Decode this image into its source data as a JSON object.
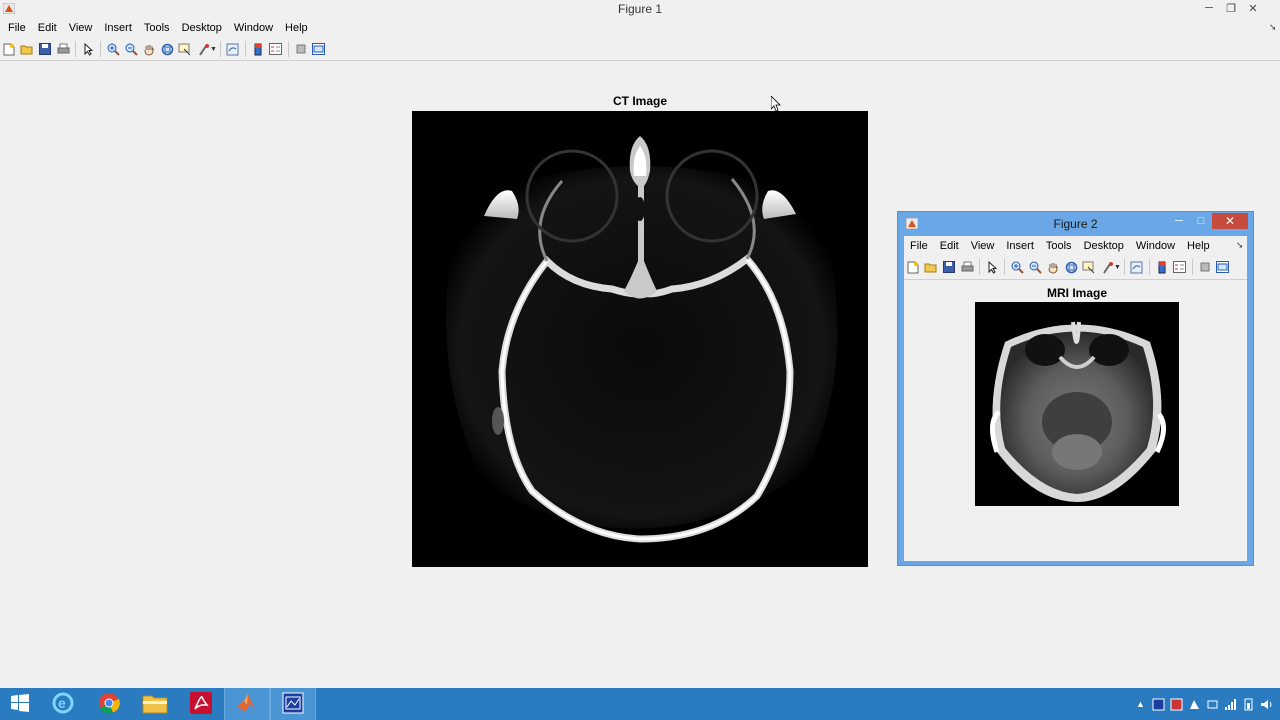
{
  "figure1": {
    "title": "Figure 1",
    "menu": [
      "File",
      "Edit",
      "View",
      "Insert",
      "Tools",
      "Desktop",
      "Window",
      "Help"
    ],
    "axes_title": "CT Image"
  },
  "figure2": {
    "title": "Figure 2",
    "menu": [
      "File",
      "Edit",
      "View",
      "Insert",
      "Tools",
      "Desktop",
      "Window",
      "Help"
    ],
    "axes_title": "MRI Image"
  },
  "window_controls": {
    "minimize": "─",
    "restore": "❐",
    "close": "✕",
    "maximize": "□"
  },
  "toolbar_icons": [
    "new-figure-icon",
    "open-file-icon",
    "save-icon",
    "print-icon",
    "edit-plot-icon",
    "zoom-in-icon",
    "zoom-out-icon",
    "pan-icon",
    "rotate-3d-icon",
    "data-cursor-icon",
    "brush-icon",
    "link-plot-icon",
    "colorbar-icon",
    "legend-icon",
    "hide-plot-tools-icon",
    "show-plot-tools-icon"
  ],
  "taskbar": {
    "apps": [
      "start-icon",
      "internet-explorer-icon",
      "chrome-icon",
      "file-explorer-icon",
      "acrobat-icon",
      "matlab-icon",
      "matlab-figure-icon"
    ]
  }
}
